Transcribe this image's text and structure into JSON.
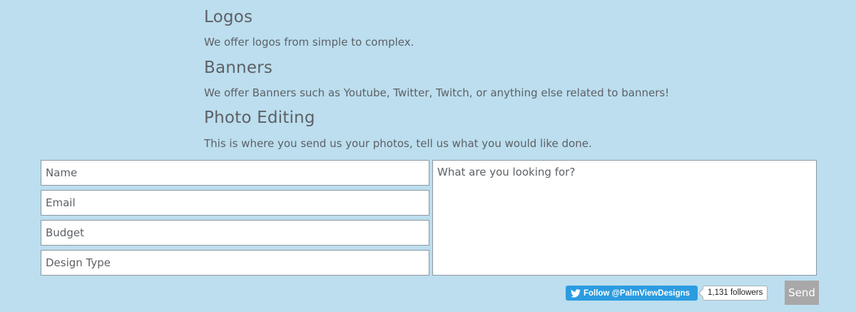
{
  "sections": [
    {
      "title": "Logos",
      "description": "We offer logos from simple to complex."
    },
    {
      "title": "Banners",
      "description": "We offer Banners such as Youtube, Twitter, Twitch, or anything else related to banners!"
    },
    {
      "title": "Photo Editing",
      "description": "This is where you send us your photos, tell us what you would like done."
    }
  ],
  "form": {
    "name_placeholder": "Name",
    "email_placeholder": "Email",
    "budget_placeholder": "Budget",
    "design_type_placeholder": "Design Type",
    "message_placeholder": "What are you looking for?",
    "send_label": "Send"
  },
  "twitter": {
    "follow_label": "Follow @PalmViewDesigns",
    "followers_label": "1,131 followers",
    "icon": "twitter-bird-icon"
  },
  "colors": {
    "background": "#bcdeee",
    "text": "#5d6166",
    "twitter_blue": "#2b9ce0",
    "send_button": "#a8a8a8"
  }
}
